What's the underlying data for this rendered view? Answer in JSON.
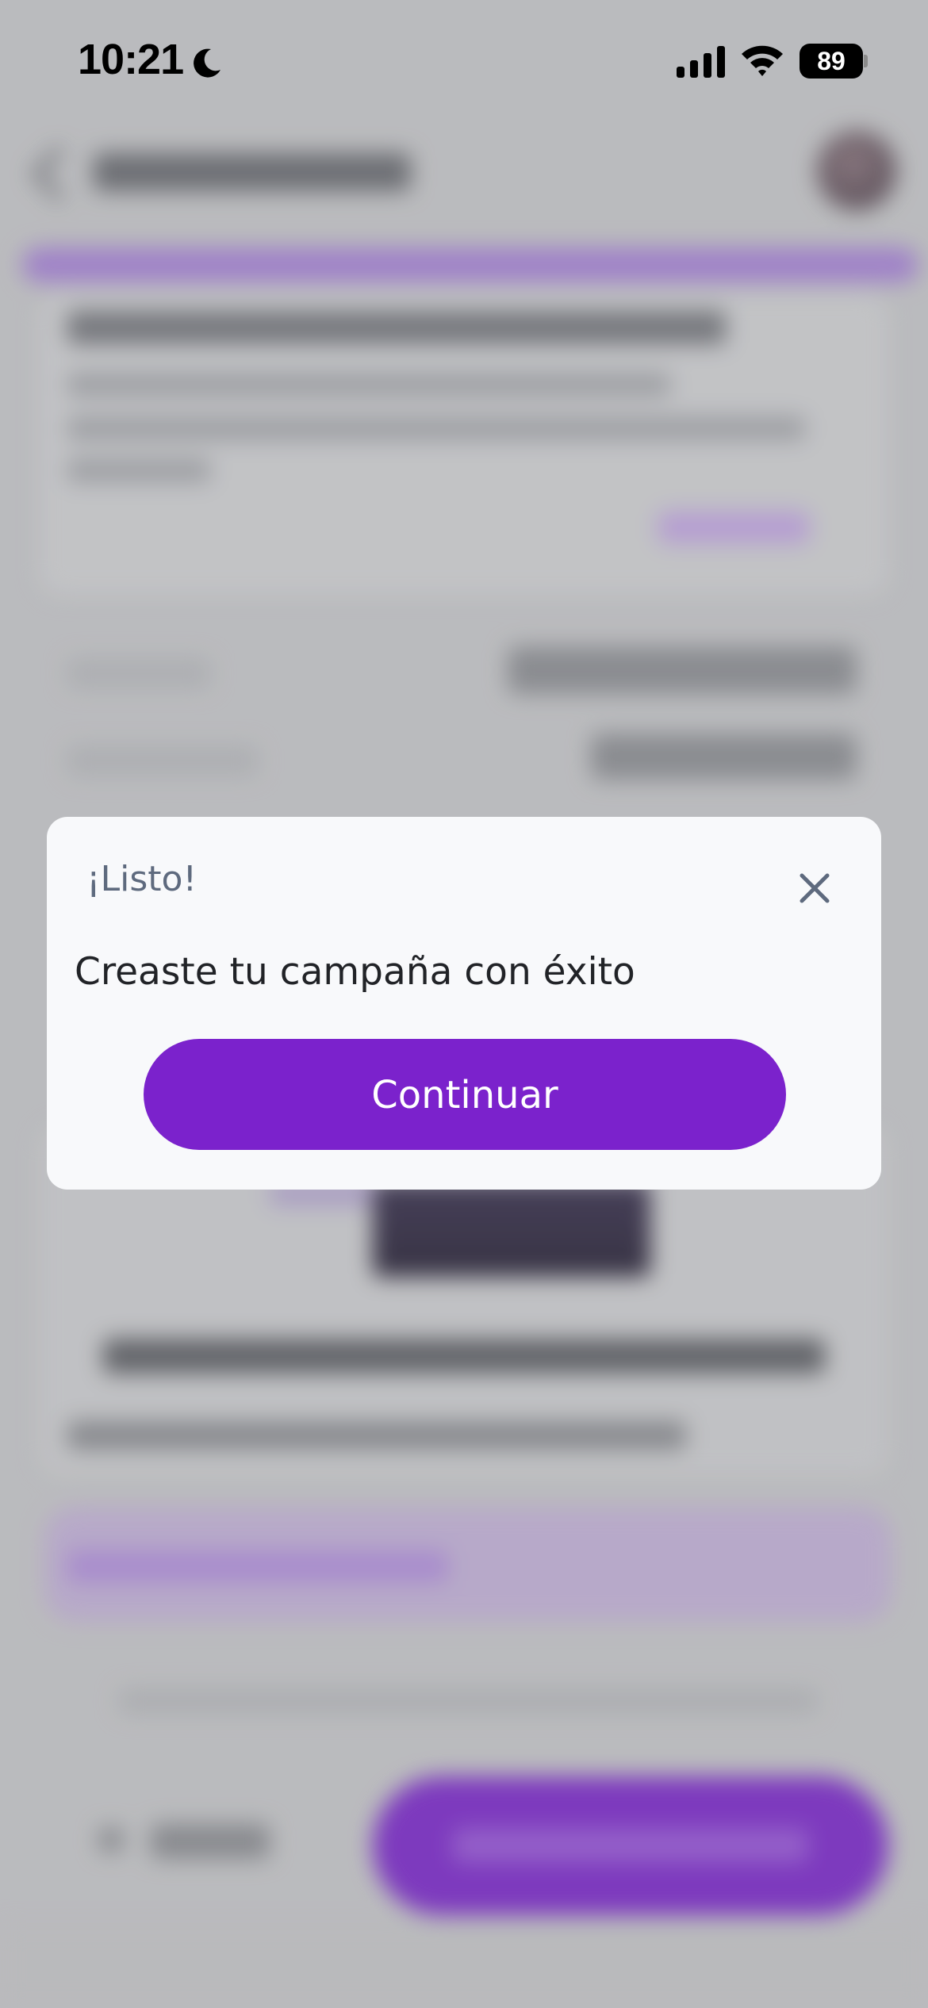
{
  "status_bar": {
    "time": "10:21",
    "battery_level": "89",
    "icons": [
      "moon-icon",
      "signal-icon",
      "wifi-icon",
      "battery-icon"
    ]
  },
  "modal": {
    "title": "¡Listo!",
    "message": "Creaste tu campaña con éxito",
    "continue_label": "Continuar",
    "close_icon": "close-icon"
  },
  "colors": {
    "primary_purple": "#7b22cc",
    "modal_background": "#f8f9fb",
    "title_gray": "#5e6a7e",
    "message_text": "#212327",
    "backdrop": "#c9cacc"
  }
}
